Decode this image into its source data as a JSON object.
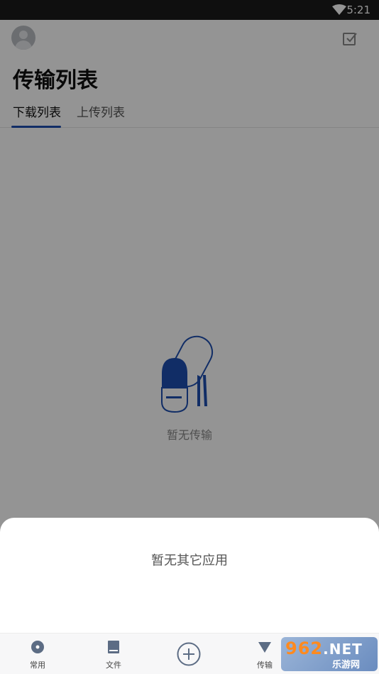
{
  "status_bar": {
    "time": "5:21"
  },
  "header": {
    "title": "传输列表"
  },
  "tabs": [
    {
      "label": "下载列表",
      "active": true
    },
    {
      "label": "上传列表",
      "active": false
    }
  ],
  "empty_state": {
    "text": "暂无传输"
  },
  "sheet": {
    "text": "暂无其它应用"
  },
  "bottom_nav": [
    {
      "label": "常用",
      "icon": "disc-icon"
    },
    {
      "label": "文件",
      "icon": "document-icon"
    },
    {
      "label": "",
      "icon": "add-circle-icon"
    },
    {
      "label": "传输",
      "icon": "transfer-triangle-icon"
    }
  ],
  "watermark": {
    "brand": "962",
    "domain": ".NET",
    "subtitle": "乐游网"
  },
  "colors": {
    "accent": "#1e4fb0",
    "overlay": "rgba(0,0,0,0.42)"
  }
}
